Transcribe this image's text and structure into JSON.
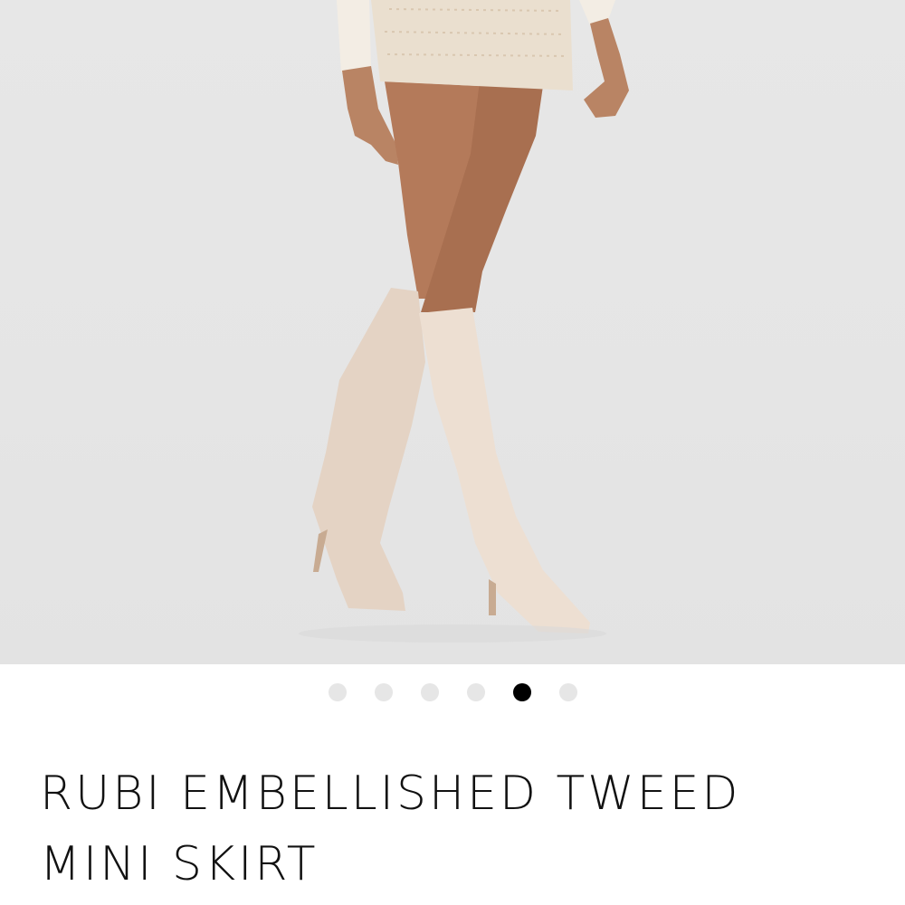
{
  "product": {
    "image_alt": "Product image",
    "title": "RUBI EMBELLISHED TWEED MINI SKIRT"
  },
  "carousel": {
    "total": 6,
    "current": 5
  },
  "colors": {
    "background": "#e6e6e6",
    "boot": "#e8d8c9",
    "skirt": "#eadfcf",
    "skin": "#b77c5c",
    "dot_inactive": "#e6e6e6",
    "dot_active": "#000000"
  }
}
